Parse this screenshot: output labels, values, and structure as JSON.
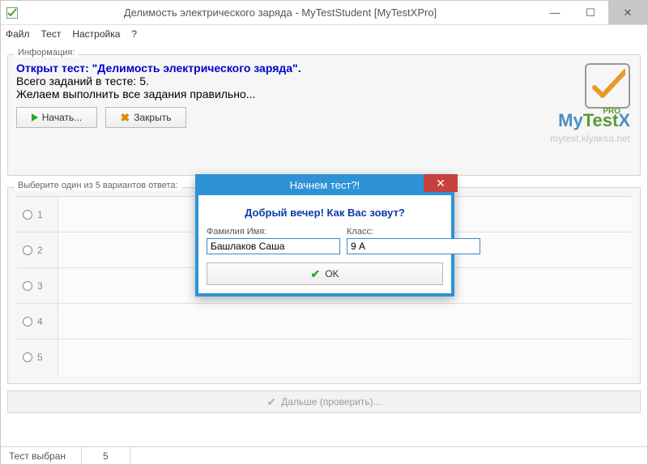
{
  "window": {
    "title": "Делимость электрического заряда - MyTestStudent [MyTestXPro]"
  },
  "menu": {
    "file": "Файл",
    "test": "Тест",
    "settings": "Настройка",
    "help": "?"
  },
  "info": {
    "group_label": "Информация:",
    "line1": "Открыт тест: \"Делимость электрического заряда\".",
    "line2": "Всего заданий в тесте: 5.",
    "line3": "Желаем выполнить все задания правильно...",
    "start_btn": "Начать...",
    "close_btn": "Закрыть"
  },
  "logo": {
    "brand": "MyTestX",
    "pro": "PRO",
    "url": "mytest.klyaksa.net"
  },
  "question": {
    "group_label": "Выберите один из 5 вариантов ответа:",
    "options": [
      "1",
      "2",
      "3",
      "4",
      "5"
    ],
    "next_label": "Дальше (проверить)..."
  },
  "status": {
    "test_selected": "Тест выбран",
    "count": "5"
  },
  "modal": {
    "title": "Начнем тест?!",
    "greeting": "Добрый вечер! Как Вас зовут?",
    "name_label": "Фамилия Имя:",
    "name_value": "Башлаков Саша",
    "class_label": "Класс:",
    "class_value": "9 А",
    "ok": "OK"
  }
}
